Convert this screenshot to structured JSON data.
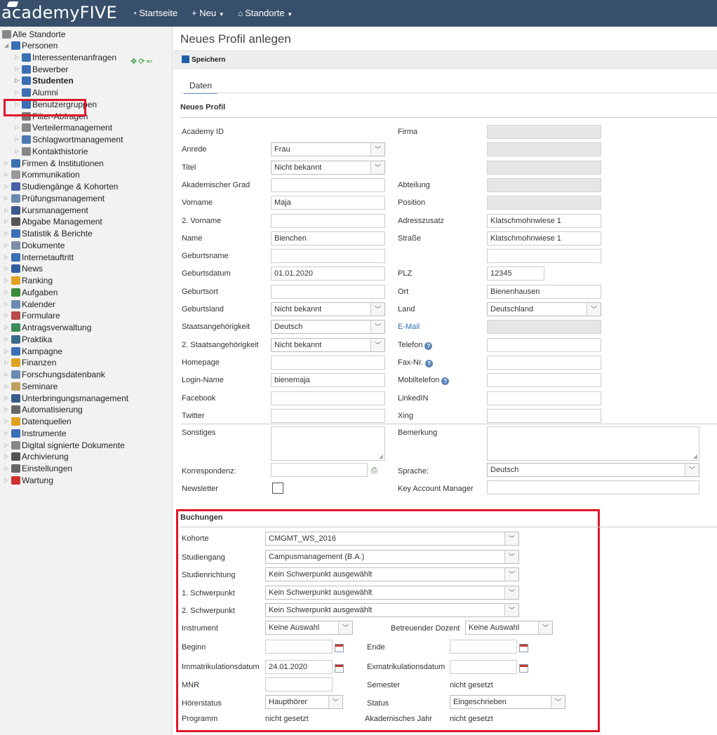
{
  "topbar": {
    "logo": "academyFIVE",
    "nav_home": "Startseite",
    "nav_new": "+ Neu",
    "nav_locations": "Standorte"
  },
  "sidebar": {
    "root": "Alle Standorte",
    "items": [
      {
        "label": "Personen",
        "level": 1,
        "color": "#3a6fb5"
      },
      {
        "label": "Interessentenanfragen",
        "level": 2,
        "color": "#3a6fb5"
      },
      {
        "label": "Bewerber",
        "level": 2,
        "color": "#3a6fb5"
      },
      {
        "label": "Studenten",
        "level": 2,
        "color": "#3a6fb5",
        "selected": true
      },
      {
        "label": "Alumni",
        "level": 2,
        "color": "#3a6fb5"
      },
      {
        "label": "Benutzergruppen",
        "level": 2,
        "color": "#3a6fb5"
      },
      {
        "label": "Filter-Abfragen",
        "level": 2,
        "color": "#777777"
      },
      {
        "label": "Verteilermanagement",
        "level": 2,
        "color": "#888888"
      },
      {
        "label": "Schlagwortmanagement",
        "level": 2,
        "color": "#4a78b0"
      },
      {
        "label": "Kontakthistorie",
        "level": 2,
        "color": "#888888"
      },
      {
        "label": "Firmen & Institutionen",
        "level": 0,
        "color": "#3b6fb0"
      },
      {
        "label": "Kommunikation",
        "level": 0,
        "color": "#999999"
      },
      {
        "label": "Studiengänge & Kohorten",
        "level": 0,
        "color": "#4a5fa8"
      },
      {
        "label": "Prüfungsmanagement",
        "level": 0,
        "color": "#6c8ab0"
      },
      {
        "label": "Kursmanagement",
        "level": 0,
        "color": "#3a5a8a"
      },
      {
        "label": "Abgabe Management",
        "level": 0,
        "color": "#555555"
      },
      {
        "label": "Statistik & Berichte",
        "level": 0,
        "color": "#3a6fb5"
      },
      {
        "label": "Dokumente",
        "level": 0,
        "color": "#7d8fa8"
      },
      {
        "label": "Internetauftritt",
        "level": 0,
        "color": "#3a6fb5"
      },
      {
        "label": "News",
        "level": 0,
        "color": "#2f5fa0"
      },
      {
        "label": "Ranking",
        "level": 0,
        "color": "#e0a020"
      },
      {
        "label": "Aufgaben",
        "level": 0,
        "color": "#3a8a3a"
      },
      {
        "label": "Kalender",
        "level": 0,
        "color": "#6c8ab0"
      },
      {
        "label": "Formulare",
        "level": 0,
        "color": "#b84a4a"
      },
      {
        "label": "Antragsverwaltung",
        "level": 0,
        "color": "#3a8a5a"
      },
      {
        "label": "Praktika",
        "level": 0,
        "color": "#3a6a8a"
      },
      {
        "label": "Kampagne",
        "level": 0,
        "color": "#3a6fb5"
      },
      {
        "label": "Finanzen",
        "level": 0,
        "color": "#e0a020"
      },
      {
        "label": "Forschungsdatenbank",
        "level": 0,
        "color": "#6c8ab0"
      },
      {
        "label": "Seminare",
        "level": 0,
        "color": "#c0a060"
      },
      {
        "label": "Unterbringungsmanagement",
        "level": 0,
        "color": "#3a5a8a"
      },
      {
        "label": "Automatisierung",
        "level": 0,
        "color": "#666666"
      },
      {
        "label": "Datenquellen",
        "level": 0,
        "color": "#e0a020"
      },
      {
        "label": "Instrumente",
        "level": 0,
        "color": "#3a6fb5"
      },
      {
        "label": "Digital signierte Dokumente",
        "level": 0,
        "color": "#888888"
      },
      {
        "label": "Archivierung",
        "level": 0,
        "color": "#555555"
      },
      {
        "label": "Einstellungen",
        "level": 0,
        "color": "#666666"
      },
      {
        "label": "Wartung",
        "level": 0,
        "color": "#d03030"
      }
    ]
  },
  "main": {
    "title": "Neues Profil anlegen",
    "save_label": "Speichern",
    "tab_daten": "Daten",
    "section_profile": "Neues Profil",
    "section_bookings": "Buchungen"
  },
  "profile_left": [
    {
      "label": "Academy ID",
      "type": "none",
      "value": ""
    },
    {
      "label": "Anrede",
      "type": "select",
      "value": "Frau"
    },
    {
      "label": "Titel",
      "type": "select",
      "value": "Nicht bekannt"
    },
    {
      "label": "Akademischer Grad",
      "type": "text",
      "value": ""
    },
    {
      "label": "Vorname",
      "type": "text",
      "value": "Maja"
    },
    {
      "label": "2. Vorname",
      "type": "text",
      "value": ""
    },
    {
      "label": "Name",
      "type": "text",
      "value": "Bienchen"
    },
    {
      "label": "Geburtsname",
      "type": "text",
      "value": ""
    },
    {
      "label": "Geburtsdatum",
      "type": "text",
      "value": "01.01.2020"
    },
    {
      "label": "Geburtsort",
      "type": "text",
      "value": ""
    },
    {
      "label": "Geburtsland",
      "type": "select",
      "value": "Nicht bekannt"
    },
    {
      "label": "Staatsangehörigkeit",
      "type": "select",
      "value": "Deutsch"
    },
    {
      "label": "2. Staatsangehörigkeit",
      "type": "select",
      "value": "Nicht bekannt"
    },
    {
      "label": "Homepage",
      "type": "text",
      "value": ""
    },
    {
      "label": "Login-Name",
      "type": "text",
      "value": "bienemaja"
    },
    {
      "label": "Facebook",
      "type": "text",
      "value": ""
    },
    {
      "label": "Twitter",
      "type": "text",
      "value": ""
    }
  ],
  "profile_right": [
    {
      "label": "Firma",
      "type": "disabled",
      "value": ""
    },
    {
      "label": "",
      "type": "disabled",
      "value": ""
    },
    {
      "label": "",
      "type": "disabled",
      "value": ""
    },
    {
      "label": "Abteilung",
      "type": "disabled",
      "value": ""
    },
    {
      "label": "Position",
      "type": "disabled",
      "value": ""
    },
    {
      "label": "Adresszusatz",
      "type": "text",
      "value": "Klatschmohnwiese 1"
    },
    {
      "label": "Straße",
      "type": "text",
      "value": "Klatschmohnwiese 1"
    },
    {
      "label": "",
      "type": "text",
      "value": ""
    },
    {
      "label": "PLZ",
      "type": "short",
      "value": "12345"
    },
    {
      "label": "Ort",
      "type": "text",
      "value": "Bienenhausen"
    },
    {
      "label": "Land",
      "type": "select",
      "value": "Deutschland"
    },
    {
      "label": "E-Mail",
      "type": "disabled",
      "value": "",
      "link": true
    },
    {
      "label": "Telefon",
      "type": "text",
      "value": "",
      "help": true
    },
    {
      "label": "Fax-Nr.",
      "type": "text",
      "value": "",
      "help": true
    },
    {
      "label": "Mobiltelefon",
      "type": "text",
      "value": "",
      "help": true
    },
    {
      "label": "LinkedIN",
      "type": "text",
      "value": ""
    },
    {
      "label": "Xing",
      "type": "text",
      "value": ""
    }
  ],
  "extra": {
    "sonstiges": "Sonstiges",
    "bemerkung": "Bemerkung",
    "korrespondenz": "Korrespondenz:",
    "sprache_label": "Sprache:",
    "sprache_value": "Deutsch",
    "newsletter": "Newsletter",
    "key_account": "Key Account Manager"
  },
  "bookings": {
    "kohorte_label": "Kohorte",
    "kohorte_value": "CMGMT_WS_2016",
    "studiengang_label": "Studiengang",
    "studiengang_value": "Campusmanagement (B.A.)",
    "studienrichtung_label": "Studienrichtung",
    "studienrichtung_value": "Kein Schwerpunkt ausgewählt",
    "schwerpunkt1_label": "1. Schwerpunkt",
    "schwerpunkt1_value": "Kein Schwerpunkt ausgewählt",
    "schwerpunkt2_label": "2. Schwerpunkt",
    "schwerpunkt2_value": "Kein Schwerpunkt ausgewählt",
    "instrument_label": "Instrument",
    "instrument_value": "Keine Auswahl",
    "dozent_label": "Betreuender Dozent",
    "dozent_value": "Keine Auswahl",
    "beginn_label": "Beginn",
    "ende_label": "Ende",
    "immatrikulation_label": "Immatrikulationsdatum",
    "immatrikulation_value": "24.01.2020",
    "exmatrikulation_label": "Exmatrikulationsdatum",
    "mnr_label": "MNR",
    "semester_label": "Semester",
    "semester_value": "nicht gesetzt",
    "hoererstatus_label": "Hörerstatus",
    "hoererstatus_value": "Haupthörer",
    "status_label": "Status",
    "status_value": "Eingeschrieben",
    "programm_label": "Programm",
    "programm_value": "nicht gesetzt",
    "akadjahr_label": "Akademisches Jahr",
    "akadjahr_value": "nicht gesetzt"
  }
}
